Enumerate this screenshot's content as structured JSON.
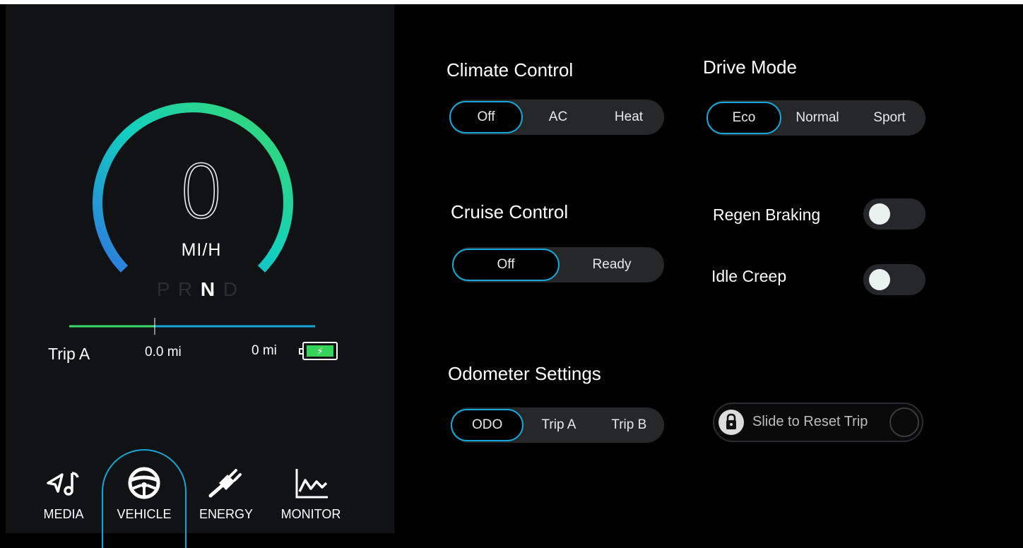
{
  "dashboard": {
    "speed": "0",
    "speed_unit": "MI/H",
    "gears": [
      "P",
      "R",
      "N",
      "D"
    ],
    "active_gear": "N",
    "trip_label": "Trip A",
    "trip_distance": "0.0 mi",
    "range": "0 mi",
    "battery_icon": "battery-charging-icon",
    "colors": {
      "gauge_start": "#2f76e0",
      "gauge_mid": "#12cfc0",
      "gauge_end": "#3ad96a",
      "accent": "#16a8d8",
      "battery": "#35d35a"
    }
  },
  "nav": [
    {
      "label": "MEDIA",
      "icon": "music-icon"
    },
    {
      "label": "VEHICLE",
      "icon": "steering-wheel-icon",
      "active": true
    },
    {
      "label": "ENERGY",
      "icon": "plug-icon"
    },
    {
      "label": "MONITOR",
      "icon": "chart-line-icon"
    }
  ],
  "climate": {
    "title": "Climate Control",
    "options": [
      "Off",
      "AC",
      "Heat"
    ],
    "selected": "Off"
  },
  "drive_mode": {
    "title": "Drive Mode",
    "options": [
      "Eco",
      "Normal",
      "Sport"
    ],
    "selected": "Eco"
  },
  "cruise": {
    "title": "Cruise Control",
    "options": [
      "Off",
      "Ready"
    ],
    "selected": "Off"
  },
  "regen_braking": {
    "label": "Regen Braking",
    "on": false
  },
  "idle_creep": {
    "label": "Idle Creep",
    "on": false
  },
  "odometer": {
    "title": "Odometer Settings",
    "options": [
      "ODO",
      "Trip A",
      "Trip B"
    ],
    "selected": "ODO"
  },
  "reset_slider": {
    "label": "Slide to Reset Trip",
    "icon": "lock-icon"
  }
}
